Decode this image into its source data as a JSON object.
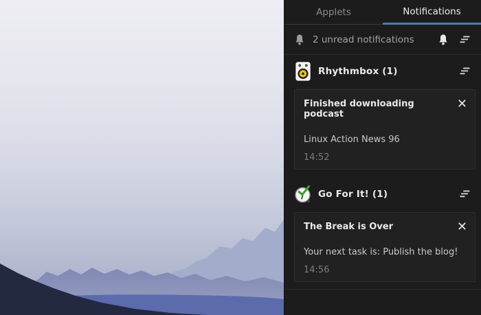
{
  "panel": {
    "tabs": [
      {
        "label": "Applets",
        "active": false
      },
      {
        "label": "Notifications",
        "active": true
      }
    ],
    "header": {
      "summary": "2 unread notifications",
      "left_icon": "bell-icon",
      "right_icons": [
        "bell-icon",
        "clear-list-icon"
      ]
    },
    "groups": [
      {
        "app_icon": "rhythmbox-icon",
        "title": "Rhythmbox (1)",
        "notifications": [
          {
            "title": "Finished downloading podcast",
            "body": "Linux Action News 96",
            "time": "14:52"
          }
        ]
      },
      {
        "app_icon": "go-for-it-icon",
        "title": "Go For It! (1)",
        "notifications": [
          {
            "title": "The Break is Over",
            "body": "Your next task is: Publish the blog!",
            "time": "14:56"
          }
        ]
      }
    ],
    "colors": {
      "accent": "#4a7bb0",
      "panel_bg": "#1c1c1c"
    }
  }
}
